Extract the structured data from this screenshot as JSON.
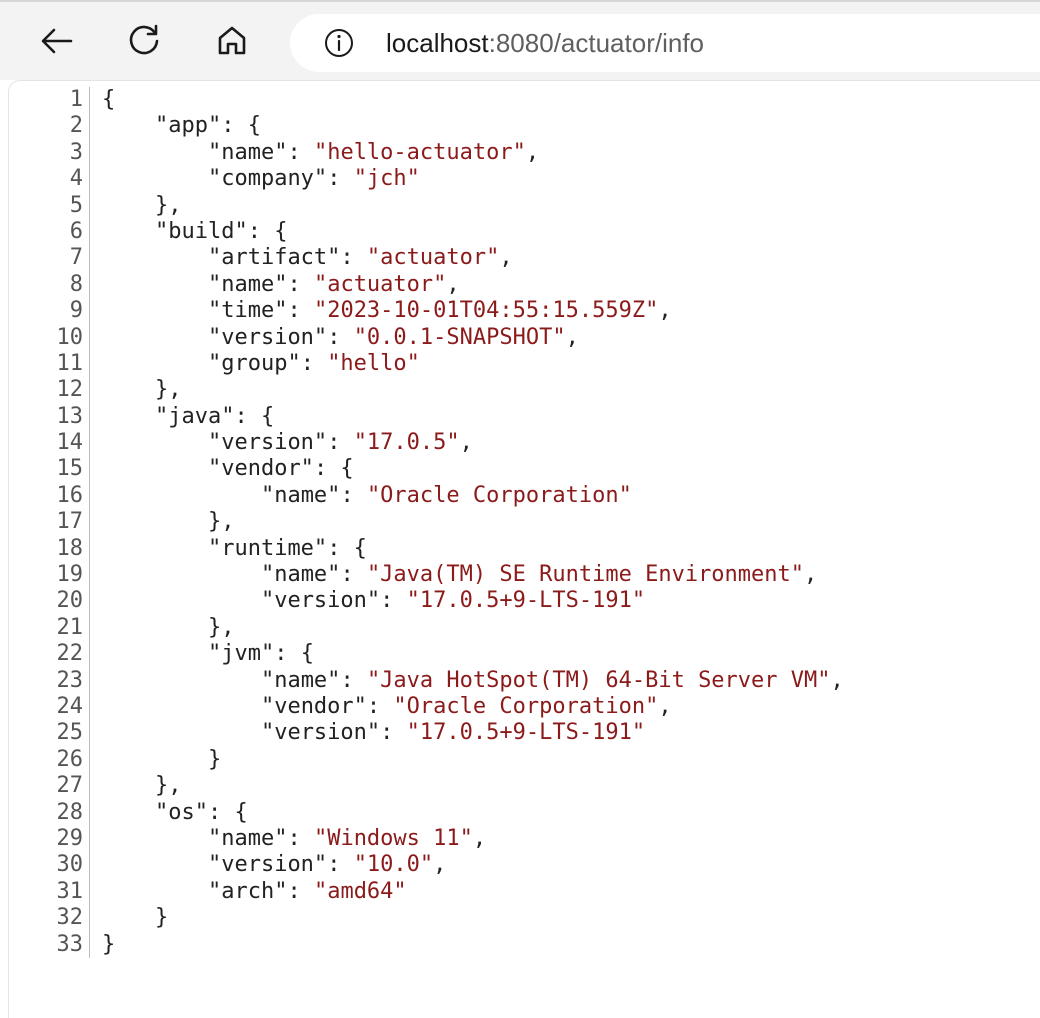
{
  "browser": {
    "url_host": "localhost",
    "url_rest": ":8080/actuator/info",
    "icons": {
      "back": "back-arrow-icon",
      "reload": "reload-icon",
      "home": "home-icon",
      "info": "info-icon"
    }
  },
  "json_viewer": {
    "lines": [
      [
        {
          "t": "p",
          "v": "{"
        }
      ],
      [
        {
          "t": "p",
          "v": "    "
        },
        {
          "t": "k",
          "v": "\"app\""
        },
        {
          "t": "p",
          "v": ": {"
        }
      ],
      [
        {
          "t": "p",
          "v": "        "
        },
        {
          "t": "k",
          "v": "\"name\""
        },
        {
          "t": "p",
          "v": ": "
        },
        {
          "t": "s",
          "v": "\"hello-actuator\""
        },
        {
          "t": "p",
          "v": ","
        }
      ],
      [
        {
          "t": "p",
          "v": "        "
        },
        {
          "t": "k",
          "v": "\"company\""
        },
        {
          "t": "p",
          "v": ": "
        },
        {
          "t": "s",
          "v": "\"jch\""
        }
      ],
      [
        {
          "t": "p",
          "v": "    },"
        }
      ],
      [
        {
          "t": "p",
          "v": "    "
        },
        {
          "t": "k",
          "v": "\"build\""
        },
        {
          "t": "p",
          "v": ": {"
        }
      ],
      [
        {
          "t": "p",
          "v": "        "
        },
        {
          "t": "k",
          "v": "\"artifact\""
        },
        {
          "t": "p",
          "v": ": "
        },
        {
          "t": "s",
          "v": "\"actuator\""
        },
        {
          "t": "p",
          "v": ","
        }
      ],
      [
        {
          "t": "p",
          "v": "        "
        },
        {
          "t": "k",
          "v": "\"name\""
        },
        {
          "t": "p",
          "v": ": "
        },
        {
          "t": "s",
          "v": "\"actuator\""
        },
        {
          "t": "p",
          "v": ","
        }
      ],
      [
        {
          "t": "p",
          "v": "        "
        },
        {
          "t": "k",
          "v": "\"time\""
        },
        {
          "t": "p",
          "v": ": "
        },
        {
          "t": "s",
          "v": "\"2023-10-01T04:55:15.559Z\""
        },
        {
          "t": "p",
          "v": ","
        }
      ],
      [
        {
          "t": "p",
          "v": "        "
        },
        {
          "t": "k",
          "v": "\"version\""
        },
        {
          "t": "p",
          "v": ": "
        },
        {
          "t": "s",
          "v": "\"0.0.1-SNAPSHOT\""
        },
        {
          "t": "p",
          "v": ","
        }
      ],
      [
        {
          "t": "p",
          "v": "        "
        },
        {
          "t": "k",
          "v": "\"group\""
        },
        {
          "t": "p",
          "v": ": "
        },
        {
          "t": "s",
          "v": "\"hello\""
        }
      ],
      [
        {
          "t": "p",
          "v": "    },"
        }
      ],
      [
        {
          "t": "p",
          "v": "    "
        },
        {
          "t": "k",
          "v": "\"java\""
        },
        {
          "t": "p",
          "v": ": {"
        }
      ],
      [
        {
          "t": "p",
          "v": "        "
        },
        {
          "t": "k",
          "v": "\"version\""
        },
        {
          "t": "p",
          "v": ": "
        },
        {
          "t": "s",
          "v": "\"17.0.5\""
        },
        {
          "t": "p",
          "v": ","
        }
      ],
      [
        {
          "t": "p",
          "v": "        "
        },
        {
          "t": "k",
          "v": "\"vendor\""
        },
        {
          "t": "p",
          "v": ": {"
        }
      ],
      [
        {
          "t": "p",
          "v": "            "
        },
        {
          "t": "k",
          "v": "\"name\""
        },
        {
          "t": "p",
          "v": ": "
        },
        {
          "t": "s",
          "v": "\"Oracle Corporation\""
        }
      ],
      [
        {
          "t": "p",
          "v": "        },"
        }
      ],
      [
        {
          "t": "p",
          "v": "        "
        },
        {
          "t": "k",
          "v": "\"runtime\""
        },
        {
          "t": "p",
          "v": ": {"
        }
      ],
      [
        {
          "t": "p",
          "v": "            "
        },
        {
          "t": "k",
          "v": "\"name\""
        },
        {
          "t": "p",
          "v": ": "
        },
        {
          "t": "s",
          "v": "\"Java(TM) SE Runtime Environment\""
        },
        {
          "t": "p",
          "v": ","
        }
      ],
      [
        {
          "t": "p",
          "v": "            "
        },
        {
          "t": "k",
          "v": "\"version\""
        },
        {
          "t": "p",
          "v": ": "
        },
        {
          "t": "s",
          "v": "\"17.0.5+9-LTS-191\""
        }
      ],
      [
        {
          "t": "p",
          "v": "        },"
        }
      ],
      [
        {
          "t": "p",
          "v": "        "
        },
        {
          "t": "k",
          "v": "\"jvm\""
        },
        {
          "t": "p",
          "v": ": {"
        }
      ],
      [
        {
          "t": "p",
          "v": "            "
        },
        {
          "t": "k",
          "v": "\"name\""
        },
        {
          "t": "p",
          "v": ": "
        },
        {
          "t": "s",
          "v": "\"Java HotSpot(TM) 64-Bit Server VM\""
        },
        {
          "t": "p",
          "v": ","
        }
      ],
      [
        {
          "t": "p",
          "v": "            "
        },
        {
          "t": "k",
          "v": "\"vendor\""
        },
        {
          "t": "p",
          "v": ": "
        },
        {
          "t": "s",
          "v": "\"Oracle Corporation\""
        },
        {
          "t": "p",
          "v": ","
        }
      ],
      [
        {
          "t": "p",
          "v": "            "
        },
        {
          "t": "k",
          "v": "\"version\""
        },
        {
          "t": "p",
          "v": ": "
        },
        {
          "t": "s",
          "v": "\"17.0.5+9-LTS-191\""
        }
      ],
      [
        {
          "t": "p",
          "v": "        }"
        }
      ],
      [
        {
          "t": "p",
          "v": "    },"
        }
      ],
      [
        {
          "t": "p",
          "v": "    "
        },
        {
          "t": "k",
          "v": "\"os\""
        },
        {
          "t": "p",
          "v": ": {"
        }
      ],
      [
        {
          "t": "p",
          "v": "        "
        },
        {
          "t": "k",
          "v": "\"name\""
        },
        {
          "t": "p",
          "v": ": "
        },
        {
          "t": "s",
          "v": "\"Windows 11\""
        },
        {
          "t": "p",
          "v": ","
        }
      ],
      [
        {
          "t": "p",
          "v": "        "
        },
        {
          "t": "k",
          "v": "\"version\""
        },
        {
          "t": "p",
          "v": ": "
        },
        {
          "t": "s",
          "v": "\"10.0\""
        },
        {
          "t": "p",
          "v": ","
        }
      ],
      [
        {
          "t": "p",
          "v": "        "
        },
        {
          "t": "k",
          "v": "\"arch\""
        },
        {
          "t": "p",
          "v": ": "
        },
        {
          "t": "s",
          "v": "\"amd64\""
        }
      ],
      [
        {
          "t": "p",
          "v": "    }"
        }
      ],
      [
        {
          "t": "p",
          "v": "}"
        }
      ]
    ],
    "line_numbers": [
      "1",
      "2",
      "3",
      "4",
      "5",
      "6",
      "7",
      "8",
      "9",
      "10",
      "11",
      "12",
      "13",
      "14",
      "15",
      "16",
      "17",
      "18",
      "19",
      "20",
      "21",
      "22",
      "23",
      "24",
      "25",
      "26",
      "27",
      "28",
      "29",
      "30",
      "31",
      "32",
      "33"
    ]
  },
  "colors": {
    "key": "#222222",
    "string": "#8b1a1a",
    "toolbar_bg": "#f3f3f3"
  }
}
